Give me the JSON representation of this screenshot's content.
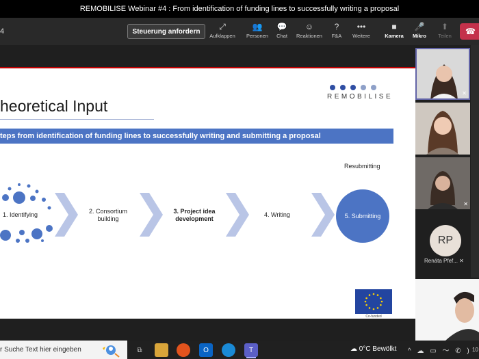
{
  "window_title": "REMOBILISE Webinar #4 : From identification of funding lines to successfully writing a proposal",
  "toolbar": {
    "timer": "4",
    "control_request": "Steuerung anfordern",
    "tools": [
      {
        "label": "Aufklappen",
        "icon": "⤢"
      },
      {
        "label": "Personen",
        "icon": "👥"
      },
      {
        "label": "Chat",
        "icon": "💬"
      },
      {
        "label": "Reaktionen",
        "icon": "☺"
      },
      {
        "label": "F&A",
        "icon": "?"
      },
      {
        "label": "Weitere",
        "icon": "•••"
      },
      {
        "label": "Kamera",
        "icon": "■"
      },
      {
        "label": "Mikro",
        "icon": "🎤"
      },
      {
        "label": "Teilen",
        "icon": "⬆"
      }
    ],
    "end_call_icon": "☎"
  },
  "slide": {
    "logo_text": "REMOBILISE",
    "title": "heoretical Input",
    "banner": "teps from identification of funding lines to successfully writing and submitting a proposal",
    "resubmitting": "Resubmitting",
    "steps": {
      "s1": "1. Identifying",
      "s2a": "2. Consortium",
      "s2b": "building",
      "s3a": "3. Project idea",
      "s3b": "development",
      "s4": "4. Writing",
      "s5": "5. Submitting"
    },
    "eu_caption": "Co-funded"
  },
  "participants": {
    "rp_initials": "RP",
    "rp_name": "Renáta Pfef..."
  },
  "taskbar": {
    "search_placeholder": "r Suche Text hier eingeben",
    "weather": "0°C  Bewölkt",
    "tray": "^ ☁ ▭ 〜 ✆ )",
    "clock": "10"
  },
  "colors": {
    "accent_blue": "#4c74c4",
    "end_call_red": "#c4314b",
    "teams_purple": "#6264a7"
  }
}
